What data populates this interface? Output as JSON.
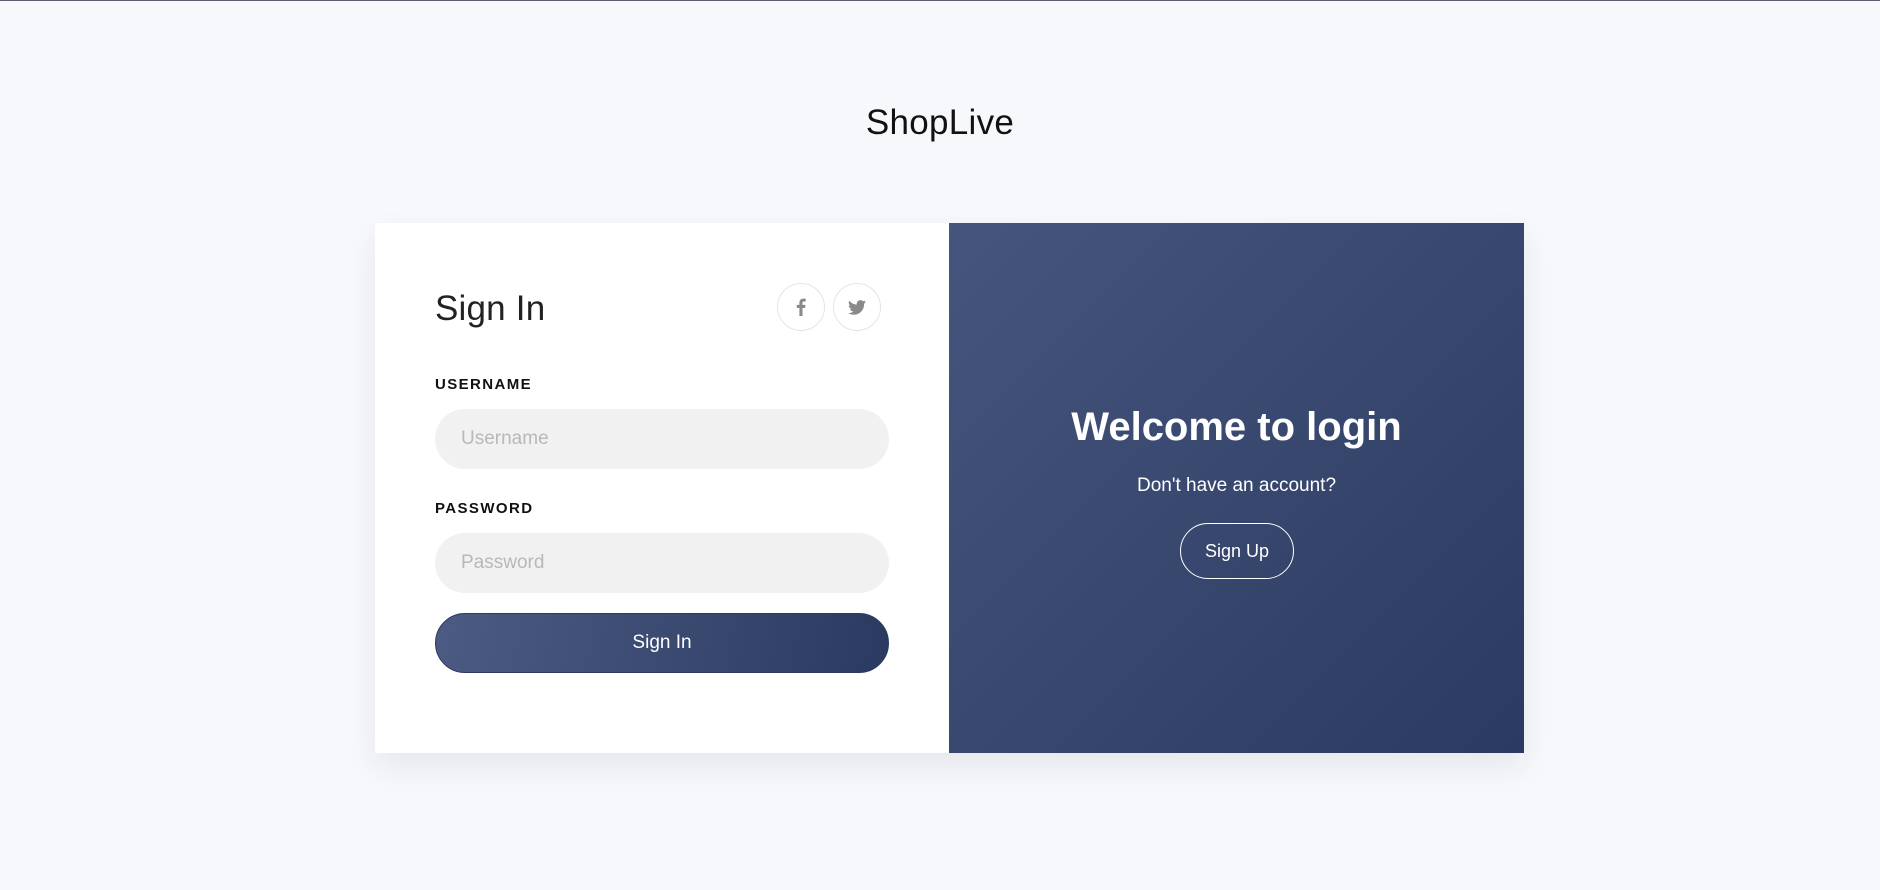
{
  "brand": {
    "name": "ShopLive"
  },
  "signin": {
    "title": "Sign In",
    "social": [
      {
        "icon": "facebook-icon"
      },
      {
        "icon": "twitter-icon"
      }
    ],
    "username": {
      "label": "USERNAME",
      "placeholder": "Username",
      "value": ""
    },
    "password": {
      "label": "PASSWORD",
      "placeholder": "Password",
      "value": ""
    },
    "submit_label": "Sign In"
  },
  "welcome_panel": {
    "heading": "Welcome to login",
    "subtext": "Don't have an account?",
    "signup_label": "Sign Up"
  },
  "colors": {
    "background": "#f7f8fb",
    "accent_start": "#45557d",
    "accent_end": "#2a3a60",
    "input_bg": "#f1f1f1"
  }
}
